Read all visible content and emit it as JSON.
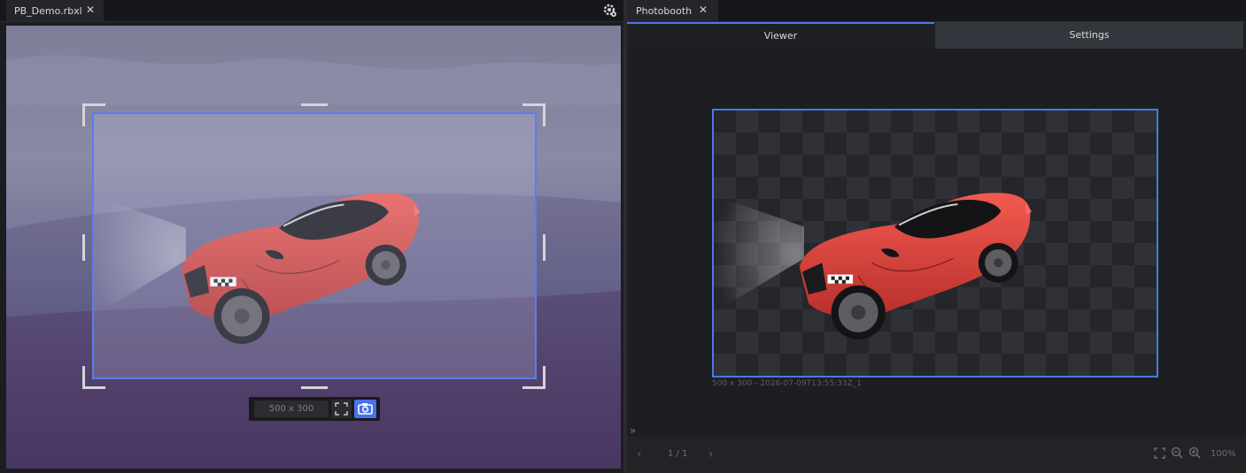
{
  "left_panel": {
    "tab_title": "PB_Demo.rbxl",
    "tab_close": "✕",
    "toolbar": {
      "size_value": "500 x 300"
    }
  },
  "right_panel": {
    "tab_title": "Photobooth",
    "tab_close": "✕",
    "subtabs": [
      "Viewer",
      "Settings"
    ],
    "active_subtab": "Viewer",
    "caption": "500 x 300 - 2026-07-09T13:55:33Z_1",
    "expand": "»",
    "pagination": {
      "prev": "‹",
      "page": "1 / 1",
      "next": "›"
    },
    "zoom": "100%"
  },
  "colors": {
    "accent": "#4a78e6",
    "car_body": "#e8473f",
    "panel_bg": "#1d1e22"
  },
  "icons": [
    "close-icon",
    "gear-icon",
    "fullscreen-icon",
    "camera-icon",
    "chevron-left-icon",
    "chevron-right-icon",
    "zoom-fit-icon",
    "zoom-out-icon",
    "zoom-in-icon",
    "double-chevron-icon"
  ]
}
